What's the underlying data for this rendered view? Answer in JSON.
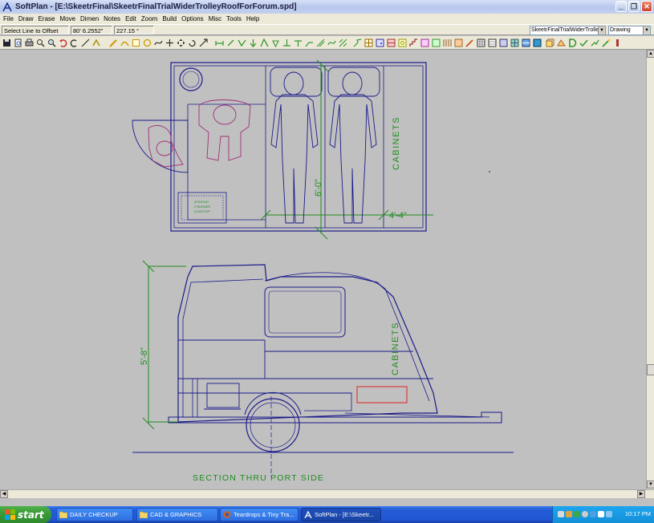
{
  "window": {
    "title": "SoftPlan - [E:\\SkeetrFinal\\SkeetrFinalTrialWiderTrolleyRoofForForum.spd]",
    "controls": {
      "minimize": "_",
      "restore": "❐",
      "close": "✕"
    }
  },
  "menu": [
    "File",
    "Draw",
    "Erase",
    "Move",
    "Dimen",
    "Notes",
    "Edit",
    "Zoom",
    "Build",
    "Options",
    "Misc",
    "Tools",
    "Help"
  ],
  "status": {
    "prompt": "Select Line to Offset",
    "coordinate": "80' 6.2552\"",
    "angle": "227.15 °",
    "file_select": "SkeetrFinalTrialWiderTrolle",
    "mode_select": "Drawing"
  },
  "drawing": {
    "plan_dimension_length": "6'-0\"",
    "plan_dimension_width": "4'-4\"",
    "plan_cabinets_label": "CABINETS",
    "stove_label_1": "ATWOOD",
    "stove_label_2": "2 BURNER",
    "stove_label_3": "COOKTOP",
    "section_height_dimension": "5'-8\"",
    "section_cabinets_label": "CABINETS",
    "section_title": "SECTION THRU PORT SIDE",
    "colors": {
      "linework": "#1a1a8a",
      "annotation": "#1f8c1f",
      "furniture": "#a0307a",
      "highlight": "#e02020"
    }
  },
  "taskbar": {
    "start_label": "start",
    "tasks": [
      {
        "label": "DAILY CHECKUP",
        "icon": "folder-icon"
      },
      {
        "label": "CAD & GRAPHICS",
        "icon": "folder-icon"
      },
      {
        "label": "Teardrops & Tiny Tra...",
        "icon": "firefox-icon"
      },
      {
        "label": "SoftPlan - [E:\\Skeetr...",
        "icon": "softplan-icon"
      }
    ],
    "clock": "10:17 PM"
  }
}
